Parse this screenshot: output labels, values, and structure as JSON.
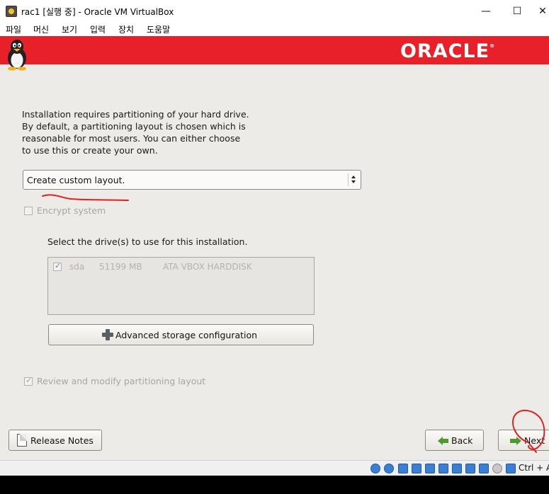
{
  "window": {
    "title": "rac1 [실행 중] - Oracle VM VirtualBox",
    "minimize": "—",
    "maximize": "☐",
    "close": "✕"
  },
  "menu": [
    "파일",
    "머신",
    "보기",
    "입력",
    "장치",
    "도움말"
  ],
  "banner": {
    "logo_text": "ORACLE",
    "registered": "®",
    "color": "#e8202a"
  },
  "installer": {
    "intro_lines": [
      "Installation requires partitioning of your hard drive.",
      "By default, a partitioning layout is chosen which is",
      "reasonable for most users.  You can either choose",
      "to use this or create your own."
    ],
    "layout_select": {
      "value": "Create custom layout."
    },
    "encrypt": {
      "label": "Encrypt system",
      "checked": false,
      "enabled": false
    },
    "drives_label": "Select the drive(s) to use for this installation.",
    "drives": [
      {
        "name": "sda",
        "size": "51199 MB",
        "model": "ATA VBOX HARDDISK",
        "checked": true
      }
    ],
    "advanced_button": "Advanced storage configuration",
    "review": {
      "label": "Review and modify partitioning layout",
      "checked": true,
      "enabled": false
    },
    "release_notes_button": "Release Notes",
    "back_button": "Back",
    "next_button": "Next"
  },
  "statusbar": {
    "host_key": "Ctrl + Al"
  },
  "annotation_color": "#e02020"
}
